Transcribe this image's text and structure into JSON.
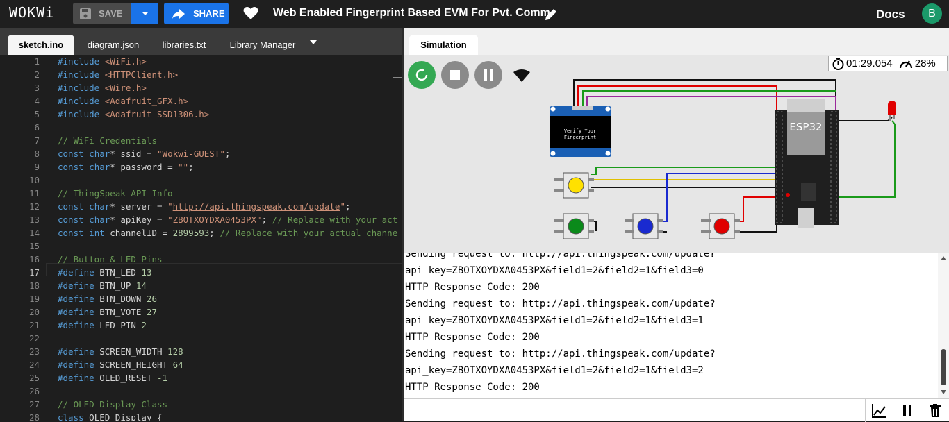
{
  "app": {
    "logo": "WOKWi",
    "save_label": "SAVE",
    "share_label": "SHARE",
    "project_title": "Web Enabled Fingerprint Based EVM For Pvt. Comm.",
    "docs_label": "Docs",
    "avatar_initial": "B"
  },
  "editor_tabs": [
    "sketch.ino",
    "diagram.json",
    "libraries.txt",
    "Library Manager"
  ],
  "active_editor_tab": "sketch.ino",
  "code_lines": [
    {
      "n": "1",
      "html": "<span class='kw'>#include</span> <span class='str'>&lt;WiFi.h&gt;</span>"
    },
    {
      "n": "2",
      "html": "<span class='kw'>#include</span> <span class='str'>&lt;HTTPClient.h&gt;</span>"
    },
    {
      "n": "3",
      "html": "<span class='kw'>#include</span> <span class='str'>&lt;Wire.h&gt;</span>"
    },
    {
      "n": "4",
      "html": "<span class='kw'>#include</span> <span class='str'>&lt;Adafruit_GFX.h&gt;</span>"
    },
    {
      "n": "5",
      "html": "<span class='kw'>#include</span> <span class='str'>&lt;Adafruit_SSD1306.h&gt;</span>"
    },
    {
      "n": "6",
      "html": ""
    },
    {
      "n": "7",
      "html": "<span class='cm'>// WiFi Credentials</span>"
    },
    {
      "n": "8",
      "html": "<span class='kw'>const</span> <span class='ty'>char</span>* ssid = <span class='str'>\"Wokwi-GUEST\"</span>;"
    },
    {
      "n": "9",
      "html": "<span class='kw'>const</span> <span class='ty'>char</span>* password = <span class='str'>\"\"</span>;"
    },
    {
      "n": "10",
      "html": ""
    },
    {
      "n": "11",
      "html": "<span class='cm'>// ThingSpeak API Info</span>"
    },
    {
      "n": "12",
      "html": "<span class='kw'>const</span> <span class='ty'>char</span>* server = <span class='str'>\"</span><span class='url'>http://api.thingspeak.com/update</span><span class='str'>\"</span>;"
    },
    {
      "n": "13",
      "html": "<span class='kw'>const</span> <span class='ty'>char</span>* apiKey = <span class='str'>\"ZBOTXOYDXA0453PX\"</span>; <span class='cm'>// Replace with your act</span>"
    },
    {
      "n": "14",
      "html": "<span class='kw'>const</span> <span class='ty'>int</span> channelID = <span class='num'>2899593</span>; <span class='cm'>// Replace with your actual channe</span>"
    },
    {
      "n": "15",
      "html": ""
    },
    {
      "n": "16",
      "html": "<span class='cm'>// Button &amp; LED Pins</span>"
    },
    {
      "n": "17",
      "html": "<span class='kw'>#define</span> BTN_LED <span class='num'>13</span>"
    },
    {
      "n": "18",
      "html": "<span class='kw'>#define</span> BTN_UP <span class='num'>14</span>"
    },
    {
      "n": "19",
      "html": "<span class='kw'>#define</span> BTN_DOWN <span class='num'>26</span>"
    },
    {
      "n": "20",
      "html": "<span class='kw'>#define</span> BTN_VOTE <span class='num'>27</span>"
    },
    {
      "n": "21",
      "html": "<span class='kw'>#define</span> LED_PIN <span class='num'>2</span>"
    },
    {
      "n": "22",
      "html": ""
    },
    {
      "n": "23",
      "html": "<span class='kw'>#define</span> SCREEN_WIDTH <span class='num'>128</span>"
    },
    {
      "n": "24",
      "html": "<span class='kw'>#define</span> SCREEN_HEIGHT <span class='num'>64</span>"
    },
    {
      "n": "25",
      "html": "<span class='kw'>#define</span> OLED_RESET <span class='num'>-1</span>"
    },
    {
      "n": "26",
      "html": ""
    },
    {
      "n": "27",
      "html": "<span class='cm'>// OLED Display Class</span>"
    },
    {
      "n": "28",
      "html": "<span class='kw'>class</span> OLED_Display {"
    }
  ],
  "current_line": "17",
  "simulation": {
    "tab_label": "Simulation",
    "timer": "01:29.054",
    "speed": "28%",
    "esp_label": "ESP32",
    "oled_text": [
      "Verify Your",
      "Fingerprint"
    ]
  },
  "serial_lines": [
    "Sending request to: http://api.thingspeak.com/update?",
    "api_key=ZBOTXOYDXA0453PX&field1=2&field2=1&field3=0",
    "HTTP Response Code: 200",
    "Sending request to: http://api.thingspeak.com/update?",
    "api_key=ZBOTXOYDXA0453PX&field1=2&field2=1&field3=1",
    "HTTP Response Code: 200",
    "Sending request to: http://api.thingspeak.com/update?",
    "api_key=ZBOTXOYDXA0453PX&field1=2&field2=1&field3=2",
    "HTTP Response Code: 200"
  ],
  "serial_input_value": "",
  "colors": {
    "accent": "#1a73e8",
    "restart": "#34a853",
    "wire_red": "#e00000",
    "wire_green": "#1a9a1a",
    "wire_purple": "#9a2a9a",
    "wire_yellow": "#e0c000",
    "wire_blue": "#1a2ad0"
  }
}
